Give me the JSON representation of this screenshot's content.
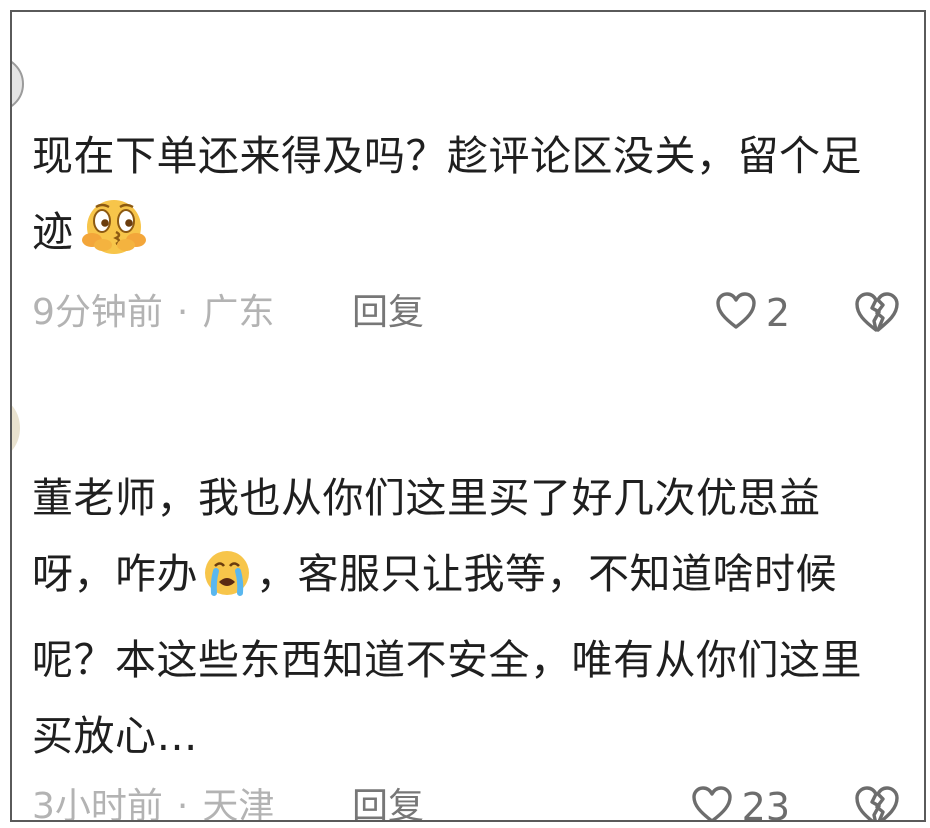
{
  "comments": [
    {
      "text_before_emoji": "现在下单还来得及吗？趁评论区没关，留个足迹",
      "emoji_icon": "thinking-hands-emoji",
      "time": "9分钟前",
      "separator": "·",
      "location": "广东",
      "reply_label": "回复",
      "like_count": "2"
    },
    {
      "text_before_emoji": "董老师，我也从你们这里买了好几次优思益呀，咋办",
      "emoji_icon": "crying-emoji",
      "text_after_emoji": "，客服只让我等，不知道啥时候呢？本这些东西知道不安全，唯有从你们这里买放心…",
      "time": "3小时前",
      "separator": "·",
      "location": "天津",
      "reply_label": "回复",
      "like_count": "23"
    }
  ],
  "colors": {
    "text": "#1f1f1f",
    "meta_text": "#b3b3b3",
    "reply_text": "#777777",
    "icon_outline": "#6d6d6d"
  }
}
